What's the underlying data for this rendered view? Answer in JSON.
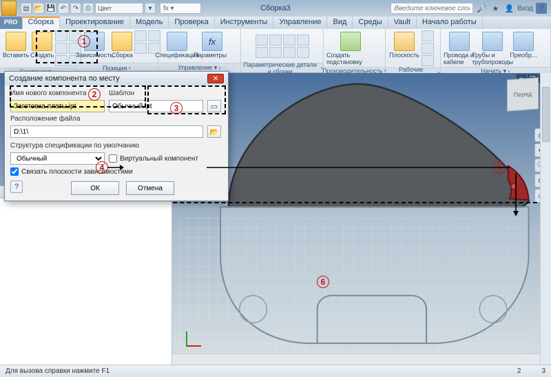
{
  "title": "Сборка3",
  "qat": {
    "color_label": "Цвет"
  },
  "fx_label": "fx ▾",
  "search": {
    "placeholder": "Введите ключевое слово/фразу"
  },
  "login_label": "Вход",
  "menutabs": {
    "pro": "PRO",
    "items": [
      "Сборка",
      "Проектирование",
      "Модель",
      "Проверка",
      "Инструменты",
      "Управление",
      "Вид",
      "Среды",
      "Vault",
      "Начало работы"
    ],
    "active_index": 0
  },
  "ribbon": {
    "panels": [
      {
        "label": "Компонент",
        "buttons": [
          "Вставить",
          "Создать"
        ]
      },
      {
        "label": "Позиция",
        "buttons": [
          "Зависимость",
          "Сборка"
        ]
      },
      {
        "label": "Управление ▾",
        "buttons": [
          "Спецификация",
          "Параметры"
        ]
      },
      {
        "label": "Параметрические детали и сборки",
        "buttons": []
      },
      {
        "label": "Производительность",
        "buttons": [
          "Создать подстановку"
        ]
      },
      {
        "label": "Рабочие элементы",
        "buttons": [
          "Плоскость"
        ]
      },
      {
        "label": "Начать ▾",
        "buttons": [
          "Провода и кабели",
          "Трубы и трубопроводы",
          "Преобр..."
        ]
      }
    ]
  },
  "dialog": {
    "title": "Создание компонента по месту",
    "labels": {
      "new_name": "Имя нового компонента",
      "template": "Шаблон",
      "location": "Расположение файла",
      "bom": "Структура спецификации по умолчанию",
      "virtual": "Виртуальный компонент",
      "constrain": "Связать плоскости зависимостями"
    },
    "values": {
      "new_name": "Заготовка платы.ipt",
      "template": "Обычный.ipt",
      "location": "D:\\1\\",
      "bom_option": "Обычный"
    },
    "buttons": {
      "ok": "ОК",
      "cancel": "Отмена"
    }
  },
  "viewcube": "Перед",
  "status": {
    "left": "Для вызова справки нажмите F1",
    "right": [
      "2",
      "3"
    ]
  },
  "annotations": [
    "1",
    "2",
    "3",
    "4",
    "5",
    "6"
  ]
}
